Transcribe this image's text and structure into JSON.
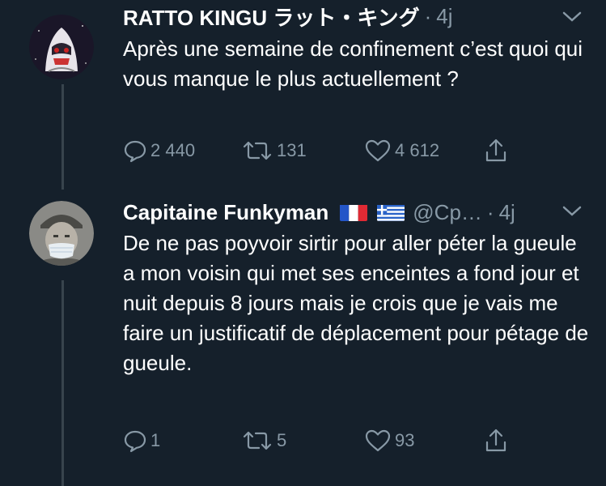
{
  "tweets": [
    {
      "name": "RATTO KINGU ラット・キング",
      "handle": "",
      "time": "4j",
      "text": "Après une semaine de confinement c’est quoi qui vous manque le plus actuellement ?",
      "replies": "2 440",
      "retweets": "131",
      "likes": "4 612"
    },
    {
      "name": "Capitaine Funkyman",
      "handle": "@Cp…",
      "time": "4j",
      "text": "De ne pas poyvoir sirtir pour aller péter la gueule a mon voisin qui met ses enceintes a fond jour et nuit depuis 8 jours mais je crois que je vais me faire un justificatif de déplacement pour pétage de gueule.",
      "replies": "1",
      "retweets": "5",
      "likes": "93"
    }
  ],
  "colors": {
    "background": "#15202b",
    "text": "#ffffff",
    "secondary": "#8899a6",
    "thread": "#38444d"
  },
  "icons": [
    "reply-icon",
    "retweet-icon",
    "like-icon",
    "share-icon",
    "chevron-down-icon"
  ],
  "separator": "·"
}
